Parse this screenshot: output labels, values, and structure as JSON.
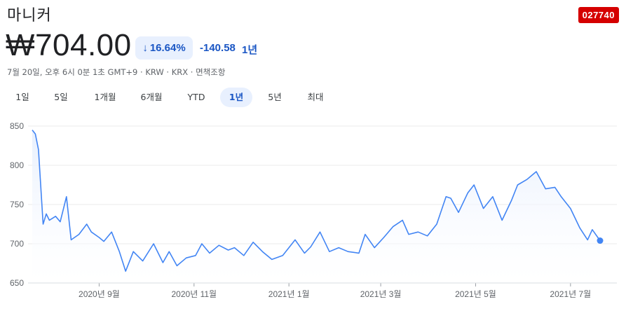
{
  "header": {
    "company_name": "마니커",
    "ticker": "027740",
    "ticker_color": "#d50000"
  },
  "quote": {
    "price": "₩704.00",
    "change_percent": "16.64%",
    "change_abs": "-140.58",
    "change_period": "1년",
    "direction_icon": "arrow-down-icon",
    "change_color": "#1a56c4"
  },
  "meta": {
    "text": "7월 20일, 오후 6시 0분 1초 GMT+9 · KRW · KRX · 면책조항"
  },
  "tabs": [
    {
      "label": "1일",
      "active": false
    },
    {
      "label": "5일",
      "active": false
    },
    {
      "label": "1개월",
      "active": false
    },
    {
      "label": "6개월",
      "active": false
    },
    {
      "label": "YTD",
      "active": false
    },
    {
      "label": "1년",
      "active": true
    },
    {
      "label": "5년",
      "active": false
    },
    {
      "label": "최대",
      "active": false
    }
  ],
  "chart_data": {
    "type": "area",
    "title": "",
    "xlabel": "",
    "ylabel": "",
    "ylim": [
      650,
      850
    ],
    "yticks": [
      650,
      700,
      750,
      800,
      850
    ],
    "x_tick_labels": [
      "2020년 9월",
      "2020년 11월",
      "2021년 1월",
      "2021년 3월",
      "2021년 5월",
      "2021년 7월"
    ],
    "x_tick_dates": [
      "2020-09-01",
      "2020-11-01",
      "2021-01-01",
      "2021-03-01",
      "2021-05-01",
      "2021-07-01"
    ],
    "grid": true,
    "line_color": "#4285f4",
    "fill_color": "#e8f0fe",
    "last_value": 704,
    "x": [
      "2020-07-20",
      "2020-07-22",
      "2020-07-24",
      "2020-07-27",
      "2020-07-29",
      "2020-07-31",
      "2020-08-04",
      "2020-08-07",
      "2020-08-11",
      "2020-08-14",
      "2020-08-19",
      "2020-08-24",
      "2020-08-27",
      "2020-09-01",
      "2020-09-04",
      "2020-09-09",
      "2020-09-14",
      "2020-09-18",
      "2020-09-23",
      "2020-09-29",
      "2020-10-06",
      "2020-10-12",
      "2020-10-16",
      "2020-10-21",
      "2020-10-27",
      "2020-11-02",
      "2020-11-06",
      "2020-11-11",
      "2020-11-17",
      "2020-11-23",
      "2020-11-27",
      "2020-12-03",
      "2020-12-09",
      "2020-12-15",
      "2020-12-21",
      "2020-12-28",
      "2021-01-05",
      "2021-01-11",
      "2021-01-15",
      "2021-01-21",
      "2021-01-27",
      "2021-02-02",
      "2021-02-08",
      "2021-02-15",
      "2021-02-19",
      "2021-02-25",
      "2021-03-03",
      "2021-03-09",
      "2021-03-15",
      "2021-03-19",
      "2021-03-25",
      "2021-03-31",
      "2021-04-06",
      "2021-04-12",
      "2021-04-15",
      "2021-04-20",
      "2021-04-26",
      "2021-04-30",
      "2021-05-06",
      "2021-05-12",
      "2021-05-18",
      "2021-05-24",
      "2021-05-28",
      "2021-06-03",
      "2021-06-09",
      "2021-06-15",
      "2021-06-21",
      "2021-06-25",
      "2021-07-01",
      "2021-07-07",
      "2021-07-12",
      "2021-07-15",
      "2021-07-20"
    ],
    "values": [
      845,
      840,
      820,
      725,
      738,
      730,
      735,
      728,
      760,
      705,
      712,
      725,
      715,
      708,
      703,
      715,
      690,
      665,
      690,
      678,
      700,
      676,
      690,
      672,
      682,
      685,
      700,
      688,
      698,
      692,
      695,
      685,
      702,
      690,
      680,
      685,
      705,
      688,
      696,
      715,
      690,
      695,
      690,
      688,
      712,
      695,
      708,
      722,
      730,
      712,
      715,
      710,
      725,
      760,
      758,
      740,
      765,
      775,
      745,
      760,
      730,
      755,
      775,
      782,
      792,
      770,
      772,
      760,
      745,
      720,
      705,
      718,
      704
    ]
  }
}
